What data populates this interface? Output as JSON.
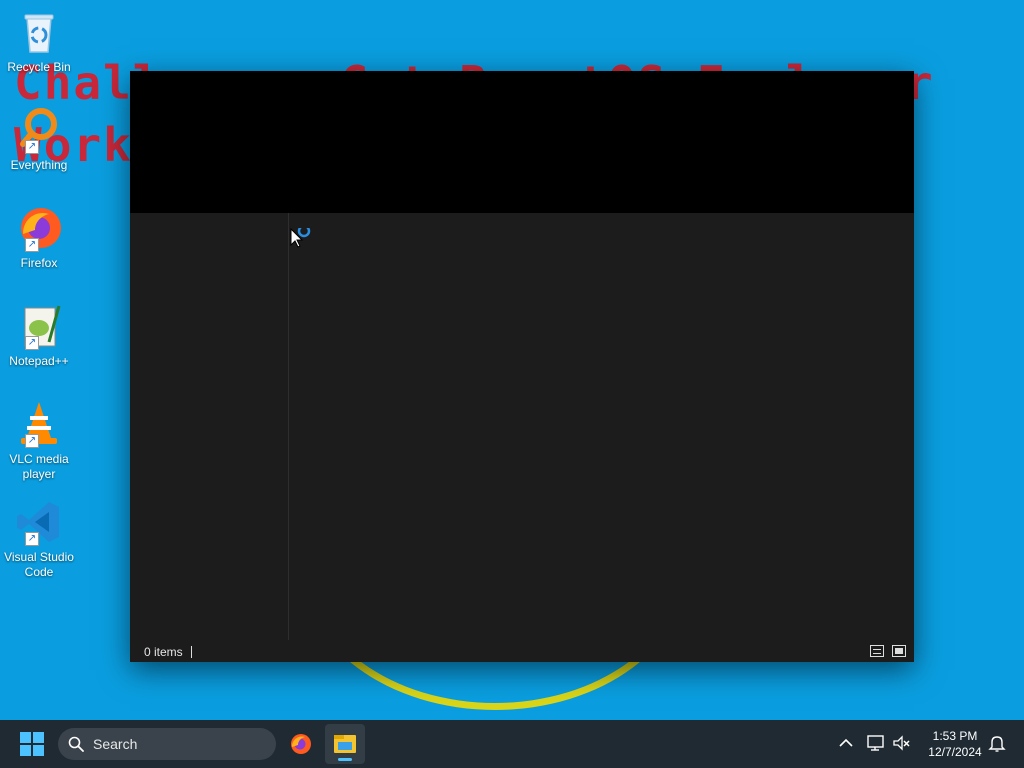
{
  "wallpaper": {
    "line1": "Challenge: Get ReactOS Explorer",
    "line2": "Work"
  },
  "desktop": {
    "icons": [
      {
        "label": "Recycle Bin",
        "icon": "recycle-bin-icon",
        "shortcut": false
      },
      {
        "label": "Everything",
        "icon": "everything-search-icon",
        "shortcut": true
      },
      {
        "label": "Firefox",
        "icon": "firefox-icon",
        "shortcut": true
      },
      {
        "label": "Notepad++",
        "icon": "notepad-plus-plus-icon",
        "shortcut": true
      },
      {
        "label": "VLC media player",
        "icon": "vlc-icon",
        "shortcut": true
      },
      {
        "label": "Visual Studio Code",
        "icon": "vscode-icon",
        "shortcut": true
      }
    ]
  },
  "explorer": {
    "status_count": "0 items",
    "views": [
      "details-view-icon",
      "large-icons-view-icon"
    ]
  },
  "taskbar": {
    "search_placeholder": "Search",
    "pinned": [
      "firefox-icon",
      "file-explorer-icon"
    ],
    "active_app": "file-explorer-icon",
    "tray": [
      "show-hidden-icons-chevron",
      "network-icon",
      "volume-muted-icon",
      "notifications-bell-icon"
    ],
    "time": "1:53 PM",
    "date": "12/7/2024"
  },
  "colors": {
    "desktop_bg": "#0a9ee0",
    "wallpaper_text": "#c8283a",
    "wallpaper_arc": "#d9d51a",
    "explorer_bg": "#1c1c1c",
    "taskbar_bg": "#1f2a33",
    "accent": "#4cc2ff"
  }
}
